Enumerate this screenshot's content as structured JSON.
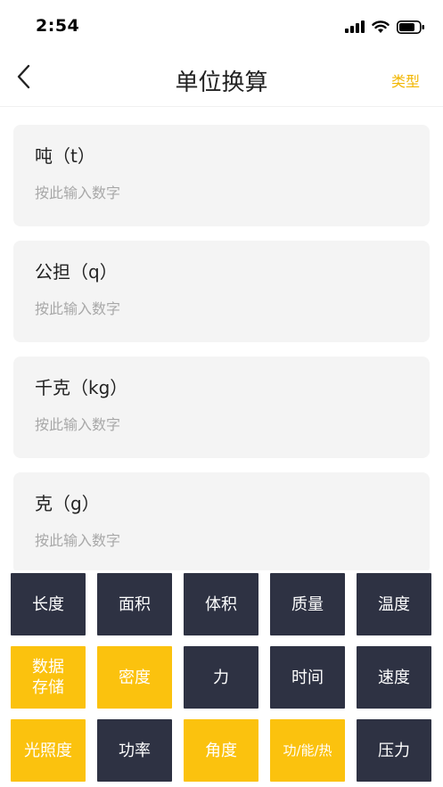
{
  "status_bar": {
    "time": "2:54"
  },
  "nav": {
    "title": "单位换算",
    "type_label": "类型"
  },
  "units": [
    {
      "label": "吨（t）",
      "placeholder": "按此输入数字"
    },
    {
      "label": "公担（q）",
      "placeholder": "按此输入数字"
    },
    {
      "label": "千克（kg）",
      "placeholder": "按此输入数字"
    },
    {
      "label": "克（g）",
      "placeholder": "按此输入数字"
    }
  ],
  "categories": [
    {
      "label": "长度",
      "color": "#2e3243"
    },
    {
      "label": "面积",
      "color": "#2e3243"
    },
    {
      "label": "体积",
      "color": "#2e3243"
    },
    {
      "label": "质量",
      "color": "#2e3243"
    },
    {
      "label": "温度",
      "color": "#2e3243"
    },
    {
      "label_line1": "数据",
      "label_line2": "存储",
      "color": "#fbc20e"
    },
    {
      "label": "密度",
      "color": "#fbc20e"
    },
    {
      "label": "力",
      "color": "#2e3243"
    },
    {
      "label": "时间",
      "color": "#2e3243"
    },
    {
      "label": "速度",
      "color": "#2e3243"
    },
    {
      "label": "光照度",
      "color": "#fbc20e"
    },
    {
      "label": "功率",
      "color": "#2e3243"
    },
    {
      "label": "角度",
      "color": "#fbc20e"
    },
    {
      "label": "功/能/热",
      "color": "#fbc20e"
    },
    {
      "label": "压力",
      "color": "#2e3243"
    }
  ],
  "colors": {
    "accent": "#fbc20e",
    "key_dark": "#2e3243",
    "card_bg": "#f4f4f4"
  },
  "icons": [
    "signal-icon",
    "wifi-icon",
    "battery-icon",
    "back-arrow-icon"
  ]
}
